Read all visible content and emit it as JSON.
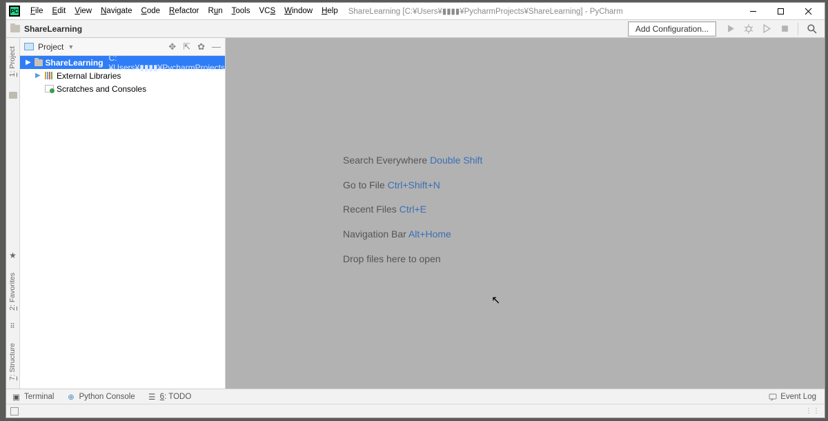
{
  "titlebar": {
    "menus": [
      "File",
      "Edit",
      "View",
      "Navigate",
      "Code",
      "Refactor",
      "Run",
      "Tools",
      "VCS",
      "Window",
      "Help"
    ],
    "path": "ShareLearning [C:¥Users¥▮▮▮▮¥PycharmProjects¥ShareLearning] - PyCharm"
  },
  "toolbar": {
    "breadcrumb": "ShareLearning",
    "add_config": "Add Configuration..."
  },
  "left_gutter": {
    "project": "1: Project",
    "favorites": "2: Favorites",
    "structure": "7: Structure"
  },
  "project_pane": {
    "title": "Project",
    "nodes": {
      "root_name": "ShareLearning",
      "root_path": "C:¥Users¥▮▮▮▮¥PycharmProjects",
      "ext_lib": "External Libraries",
      "scratches": "Scratches and Consoles"
    }
  },
  "editor_hints": {
    "l1a": "Search Everywhere ",
    "l1b": "Double Shift",
    "l2a": "Go to File ",
    "l2b": "Ctrl+Shift+N",
    "l3a": "Recent Files ",
    "l3b": "Ctrl+E",
    "l4a": "Navigation Bar ",
    "l4b": "Alt+Home",
    "l5": "Drop files here to open"
  },
  "bottom": {
    "terminal": "Terminal",
    "python_console": "Python Console",
    "todo_pre": "6",
    "todo_post": ": TODO",
    "event_log": "Event Log"
  }
}
